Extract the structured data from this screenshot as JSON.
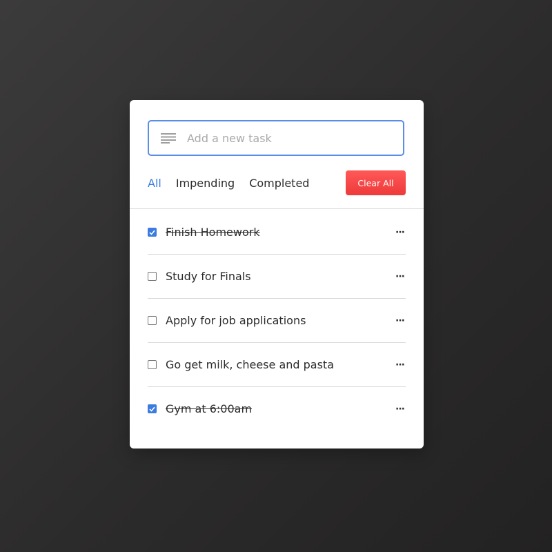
{
  "input": {
    "placeholder": "Add a new task",
    "icon": "lines-icon"
  },
  "filters": [
    {
      "label": "All",
      "active": true
    },
    {
      "label": "Impending",
      "active": false
    },
    {
      "label": "Completed",
      "active": false
    }
  ],
  "clear_button": {
    "label": "Clear All"
  },
  "tasks": [
    {
      "text": "Finish Homework",
      "done": true,
      "menu": "···"
    },
    {
      "text": "Study for Finals",
      "done": false,
      "menu": "···"
    },
    {
      "text": "Apply for job applications",
      "done": false,
      "menu": "···"
    },
    {
      "text": "Go get milk, cheese and pasta",
      "done": false,
      "menu": "···"
    },
    {
      "text": "Gym at 6:00am",
      "done": true,
      "menu": "···"
    }
  ],
  "colors": {
    "accent": "#3b7ce0",
    "input_border": "#5a8de6",
    "clear_button": "#ee3a3a",
    "card": "#ffffff",
    "background": "#2c2b2b"
  }
}
